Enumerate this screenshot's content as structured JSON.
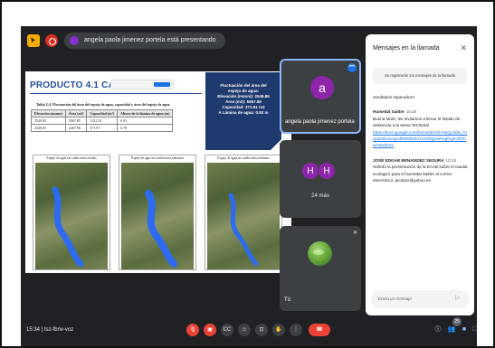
{
  "topbar": {
    "presenting_text": "angela paola jimenez portela está presentando"
  },
  "slide": {
    "title": "PRODUCTO 4.1 CAUDAL A",
    "info_box": [
      "Fluctuación del área del",
      "espejo de agua:",
      "Elevación (msnm): 2549.85",
      "Área (m2): 5567.85",
      "Capacidad: 371.91 m3",
      "A Lámina de agua: 0.93 m"
    ],
    "table_caption": "Tabla 2-4. Fluctuación del área del espejo de agua, capacidad y área del espejo de agua",
    "table": {
      "headers": [
        "Elevación (msnm)",
        "Área (m²)",
        "Capacidad (m³)",
        "Altura de la lámina de agua (m)"
      ],
      "rows": [
        [
          "2549.85",
          "5567.85",
          "1121.54",
          "0.93"
        ],
        [
          "2549.05",
          "2267.96",
          "371.97",
          "0.78"
        ]
      ]
    },
    "panels": [
      "Espejo de agua en condiciones medias",
      "Espejo de agua en condiciones máximas",
      "Espejo de agua en condiciones mínimas"
    ]
  },
  "tiles": {
    "presenter": {
      "initial": "a",
      "name": "angela paola jimenez portela"
    },
    "group": {
      "initials": [
        "H",
        "H"
      ],
      "count_label": "24 más"
    },
    "self": {
      "label": "Tú"
    }
  },
  "chat": {
    "title": "Mensajes en la llamada",
    "notice": "Se registrarán los mensajes de la llamada",
    "preface": "resultados esperados?",
    "messages": [
      {
        "author": "Humedal Salitre",
        "time": "15:28",
        "text": "Buena tarde, les invitamos a llenar el listado de asistencia a la Mesa Territorial",
        "link": "https://docs.google.com/forms/d/e/1FAIpQLSdw_fAwqs0dGwxqUd6hRM2hXzoXIRQpwPwgDyjtCPtrTiw/viewform"
      },
      {
        "author": "JOSÉ EDGAR BENAVIDEZ SEGURA",
        "time": "15:28",
        "text": "Solicito la presentación de la EAAB sobre el caudal ecológico para el humedal Salitre al correo electrónico: jecobos@yahoo.es"
      }
    ],
    "input_placeholder": "Envía un mensaje"
  },
  "bottombar": {
    "time": "15:34",
    "meeting_code": "tsz-fbnv-voz",
    "participants_badge": "25"
  }
}
